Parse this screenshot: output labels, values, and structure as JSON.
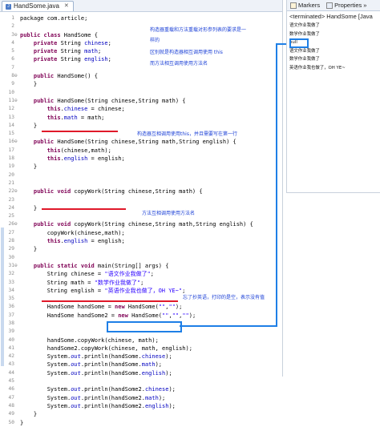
{
  "editor": {
    "tab_label": "HandSome.java",
    "lines": [
      {
        "n": "1",
        "html": "package com.article;"
      },
      {
        "n": "2",
        "html": ""
      },
      {
        "n": "3",
        "html": "<span class='kw'>public class</span> HandSome {"
      },
      {
        "n": "4",
        "html": "    <span class='kw'>private</span> String <span class='fld'>chinese</span>;"
      },
      {
        "n": "5",
        "html": "    <span class='kw'>private</span> String <span class='fld'>math</span>;"
      },
      {
        "n": "6",
        "html": "    <span class='kw'>private</span> String <span class='fld'>english</span>;"
      },
      {
        "n": "7",
        "html": ""
      },
      {
        "n": "8",
        "html": "    <span class='kw'>public</span> HandSome() {"
      },
      {
        "n": "9",
        "html": "    }"
      },
      {
        "n": "10",
        "html": ""
      },
      {
        "n": "11",
        "html": "    <span class='kw'>public</span> HandSome(String chinese,String math) {"
      },
      {
        "n": "12",
        "html": "        <span class='kw'>this</span>.<span class='fld'>chinese</span> = chinese;"
      },
      {
        "n": "13",
        "html": "        <span class='kw'>this</span>.<span class='fld'>math</span> = math;"
      },
      {
        "n": "14",
        "html": "    }"
      },
      {
        "n": "15",
        "html": ""
      },
      {
        "n": "16",
        "html": "    <span class='kw'>public</span> HandSome(String chinese,String math,String english) {"
      },
      {
        "n": "17",
        "html": "        <span class='kw'>this</span>(chinese,math);"
      },
      {
        "n": "18",
        "html": "        <span class='kw'>this</span>.<span class='fld'>english</span> = english;"
      },
      {
        "n": "19",
        "html": "    }"
      },
      {
        "n": "20",
        "html": ""
      },
      {
        "n": "21",
        "html": ""
      },
      {
        "n": "22",
        "html": "    <span class='kw'>public void</span> copyWork(String chinese,String math) {"
      },
      {
        "n": "23",
        "html": ""
      },
      {
        "n": "24",
        "html": "    }"
      },
      {
        "n": "25",
        "html": ""
      },
      {
        "n": "26",
        "html": "    <span class='kw'>public void</span> copyWork(String chinese,String math,String english) {"
      },
      {
        "n": "27",
        "html": "        copyWork(chinese,math);"
      },
      {
        "n": "28",
        "html": "        <span class='kw'>this</span>.<span class='fld'>english</span> = english;"
      },
      {
        "n": "29",
        "html": "    }"
      },
      {
        "n": "30",
        "html": ""
      },
      {
        "n": "31",
        "html": "    <span class='kw'>public static void</span> main(String[] args) {"
      },
      {
        "n": "32",
        "html": "        String chinese = <span class='str'>\"语文作业我做了\"</span>;"
      },
      {
        "n": "33",
        "html": "        String math = <span class='str'>\"数学作业我做了\"</span>;"
      },
      {
        "n": "34",
        "html": "        String english = <span class='str'>\"英语作业我也做了，OH YE~\"</span>;"
      },
      {
        "n": "35",
        "html": ""
      },
      {
        "n": "36",
        "html": "        HandSome handSome = <span class='kw'>new</span> HandSome(<span class='str'>\"\"</span>,<span class='str'>\"\"</span>);"
      },
      {
        "n": "37",
        "html": "        HandSome handSome2 = <span class='kw'>new</span> HandSome(<span class='str'>\"\"</span>,<span class='str'>\"\"</span>,<span class='str'>\"\"</span>);"
      },
      {
        "n": "38",
        "html": ""
      },
      {
        "n": "39",
        "html": ""
      },
      {
        "n": "40",
        "html": "        handSome.copyWork(chinese, math);"
      },
      {
        "n": "41",
        "html": "        handSome2.copyWork(chinese, math, english);"
      },
      {
        "n": "42",
        "html": "        System.<span class='fld it'>out</span>.println(handSome.<span class='fld'>chinese</span>);"
      },
      {
        "n": "43",
        "html": "        System.<span class='fld it'>out</span>.println(handSome.<span class='fld'>math</span>);"
      },
      {
        "n": "44",
        "html": "        System.<span class='fld it'>out</span>.println(handSome.<span class='fld'>english</span>);"
      },
      {
        "n": "45",
        "html": ""
      },
      {
        "n": "46",
        "html": "        System.<span class='fld it'>out</span>.println(handSome2.<span class='fld'>chinese</span>);"
      },
      {
        "n": "47",
        "html": "        System.<span class='fld it'>out</span>.println(handSome2.<span class='fld'>math</span>);"
      },
      {
        "n": "48",
        "html": "        System.<span class='fld it'>out</span>.println(handSome2.<span class='fld'>english</span>);"
      },
      {
        "n": "49",
        "html": "    }"
      },
      {
        "n": "50",
        "html": "}"
      }
    ]
  },
  "annotations": {
    "note1_line1": "构造器重载和方法重载对形参列表的要求是一",
    "note1_line2": "样的",
    "note2_line1": "区别就是构造器相互调用使用 this",
    "note2_line2": "而方法相互调用使用方法名",
    "note3": "构造器互相调用使用this，并且需要写在第一行",
    "note4": "方法互相调用使用方法名",
    "note5": "忘了抄英语，打印的是空，表示没有值"
  },
  "console": {
    "tab_markers": "Markers",
    "tab_properties": "Properties",
    "tab_more": "»",
    "terminated": "<terminated> HandSome [Java",
    "output": [
      "语文作业我做了",
      "数学作业我做了",
      "null",
      "语文作业我做了",
      "数学作业我做了",
      "英语作业我也做了，OH YE~"
    ]
  }
}
